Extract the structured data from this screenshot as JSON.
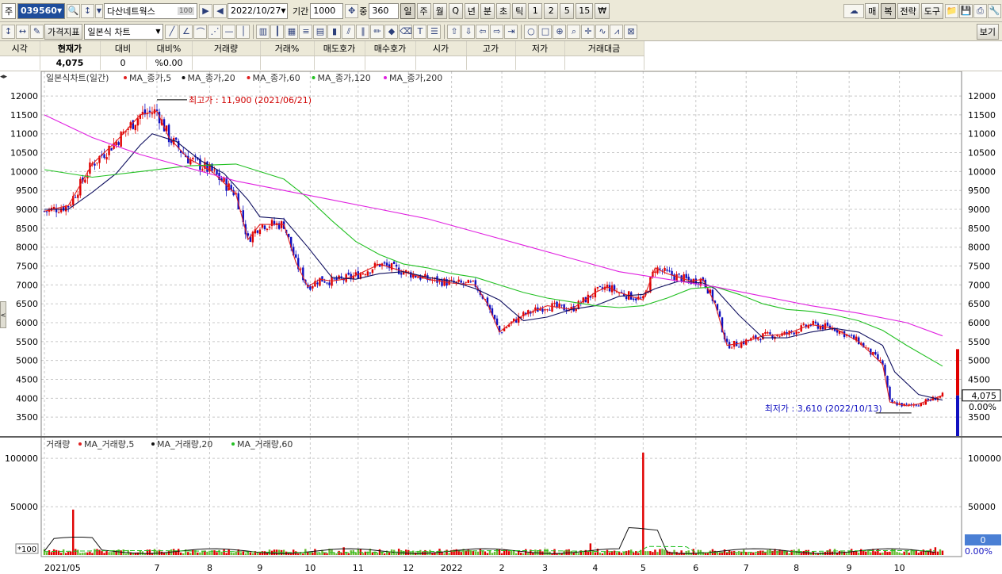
{
  "toolbar1": {
    "market_label": "주",
    "code": "039560",
    "name": "다산네트웍스",
    "name_badge": "100",
    "date": "2022/10/27",
    "period_label": "기간",
    "period_value": "1000",
    "zoom_label": "중",
    "zoom_value": "360",
    "intervals": [
      "일",
      "주",
      "월",
      "Q",
      "년",
      "분",
      "초",
      "틱",
      "1",
      "2",
      "5",
      "15",
      "₩"
    ],
    "right_buttons": [
      "매",
      "복",
      "전략",
      "도구"
    ]
  },
  "toolbar2": {
    "indicator_button": "가격지표",
    "chart_type": "일본식 차트",
    "view_button": "보기"
  },
  "quote": {
    "headers": [
      "시각",
      "현재가",
      "대비",
      "대비%",
      "거래량",
      "거래%",
      "매도호가",
      "매수호가",
      "시가",
      "고가",
      "저가",
      "거래대금"
    ],
    "values": [
      "",
      "4,075",
      "0",
      "%0.00",
      "",
      "",
      "",
      "",
      "",
      "",
      "",
      ""
    ]
  },
  "price_chart": {
    "legend_title": "일본식차트(일간)",
    "legend_items": [
      {
        "label": "MA_종가,5",
        "color": "#e02020"
      },
      {
        "label": "MA_종가,20",
        "color": "#000000"
      },
      {
        "label": "MA_종가,60",
        "color": "#e02020"
      },
      {
        "label": "MA_종가,120",
        "color": "#22c022"
      },
      {
        "label": "MA_종가,200",
        "color": "#e020e0"
      }
    ],
    "high_label": "최고가 : 11,900 (2021/06/21)",
    "low_label": "최저가 : 3,610 (2022/10/13)",
    "current_price": "4,075",
    "current_pct": "0.00%"
  },
  "volume_chart": {
    "legend_title": "거래량",
    "legend_items": [
      {
        "label": "MA_거래량,5",
        "color": "#e02020"
      },
      {
        "label": "MA_거래량,20",
        "color": "#000000"
      },
      {
        "label": "MA_거래량,60",
        "color": "#22c022"
      }
    ],
    "scale_note": "*100",
    "current_value": "0",
    "current_pct": "0.00%"
  },
  "colors": {
    "up": "#e00000",
    "down": "#1010c0"
  },
  "chart_data": {
    "type": "line",
    "price_axis": {
      "ticks": [
        3500,
        4000,
        4500,
        5000,
        5500,
        6000,
        6500,
        7000,
        7500,
        8000,
        8500,
        9000,
        9500,
        10000,
        10500,
        11000,
        11500,
        12000
      ],
      "ylim": [
        3000,
        12400
      ]
    },
    "volume_axis": {
      "ticks": [
        50000,
        100000
      ],
      "ylim": [
        0,
        110000
      ]
    },
    "x_tick_labels": [
      "2021/05",
      "7",
      "8",
      "9",
      "10",
      "11",
      "12",
      "2022",
      "2",
      "3",
      "4",
      "5",
      "6",
      "7",
      "8",
      "9",
      "10"
    ],
    "x_tick_day_index": [
      0,
      47,
      69,
      90,
      111,
      131,
      152,
      170,
      191,
      209,
      230,
      250,
      272,
      293,
      314,
      336,
      357
    ],
    "total_days": 376,
    "series": [
      {
        "name": "MA_종가,5",
        "x": [
          0,
          10,
          20,
          30,
          40,
          47,
          52,
          60,
          70,
          80,
          85,
          90,
          100,
          105,
          110,
          115,
          120,
          125,
          130,
          140,
          150,
          160,
          170,
          180,
          185,
          190,
          195,
          200,
          210,
          220,
          230,
          235,
          240,
          250,
          255,
          260,
          270,
          275,
          280,
          285,
          290,
          300,
          310,
          320,
          330,
          340,
          350,
          353,
          360,
          365,
          375
        ],
        "values": [
          8950,
          9100,
          10200,
          10800,
          11500,
          11600,
          10900,
          10350,
          10000,
          9400,
          8200,
          8600,
          8600,
          7600,
          6950,
          7150,
          7100,
          7150,
          7250,
          7550,
          7350,
          7150,
          7050,
          7000,
          6500,
          5750,
          6000,
          6200,
          6450,
          6350,
          6800,
          6950,
          6800,
          6600,
          7450,
          7300,
          7100,
          7150,
          6500,
          5400,
          5450,
          5650,
          5700,
          5950,
          5850,
          5500,
          4900,
          3900,
          3800,
          3850,
          4075
        ]
      },
      {
        "name": "MA_종가,20",
        "x": [
          0,
          10,
          20,
          30,
          40,
          45,
          55,
          65,
          75,
          85,
          90,
          100,
          110,
          120,
          130,
          140,
          150,
          160,
          170,
          180,
          190,
          200,
          210,
          220,
          230,
          240,
          250,
          255,
          265,
          275,
          280,
          290,
          300,
          310,
          320,
          330,
          340,
          350,
          355,
          365,
          375
        ],
        "values": [
          9000,
          9000,
          9450,
          9950,
          10700,
          11000,
          10800,
          10300,
          9950,
          9250,
          8800,
          8750,
          8000,
          7200,
          7150,
          7300,
          7350,
          7200,
          7100,
          6900,
          6600,
          6050,
          6150,
          6350,
          6450,
          6700,
          6750,
          6900,
          7100,
          7050,
          6900,
          6200,
          5600,
          5600,
          5750,
          5850,
          5750,
          5400,
          4700,
          4100,
          3950
        ]
      },
      {
        "name": "MA_종가,120",
        "x": [
          0,
          20,
          40,
          60,
          80,
          100,
          110,
          120,
          130,
          140,
          150,
          160,
          170,
          180,
          190,
          200,
          210,
          220,
          230,
          240,
          250,
          260,
          270,
          280,
          290,
          300,
          310,
          320,
          330,
          340,
          350,
          360,
          375
        ],
        "values": [
          10050,
          9850,
          10000,
          10150,
          10200,
          9800,
          9300,
          8700,
          8150,
          7800,
          7550,
          7450,
          7300,
          7200,
          7000,
          6800,
          6650,
          6550,
          6450,
          6400,
          6450,
          6650,
          6900,
          6950,
          6750,
          6500,
          6350,
          6300,
          6200,
          6050,
          5800,
          5400,
          4850
        ]
      },
      {
        "name": "MA_종가,200",
        "x": [
          0,
          20,
          40,
          60,
          80,
          100,
          120,
          140,
          160,
          180,
          200,
          220,
          240,
          260,
          280,
          300,
          320,
          340,
          360,
          375
        ],
        "values": [
          11500,
          10900,
          10450,
          10100,
          9750,
          9500,
          9250,
          9000,
          8750,
          8400,
          8050,
          7700,
          7350,
          7150,
          6950,
          6700,
          6450,
          6250,
          6000,
          5650
        ]
      },
      {
        "name": "MA_종가,60",
        "x": [
          0,
          20,
          40,
          60,
          80,
          100,
          120,
          140,
          160,
          180,
          200,
          220,
          240,
          260,
          280,
          300,
          320,
          340,
          360,
          375
        ],
        "values": [
          11900,
          11750,
          11550,
          11350,
          11050,
          10750,
          10300,
          9800,
          9350,
          8900,
          8500,
          8100,
          7700,
          7400,
          7000,
          6700,
          6500,
          6400,
          6200,
          6000
        ]
      }
    ],
    "volume_spikes": [
      {
        "day": 12,
        "value": 47000
      },
      {
        "day": 228,
        "value": 12000
      },
      {
        "day": 250,
        "value": 106000
      },
      {
        "day": 125,
        "value": 8000
      },
      {
        "day": 372,
        "value": 8000
      }
    ]
  }
}
